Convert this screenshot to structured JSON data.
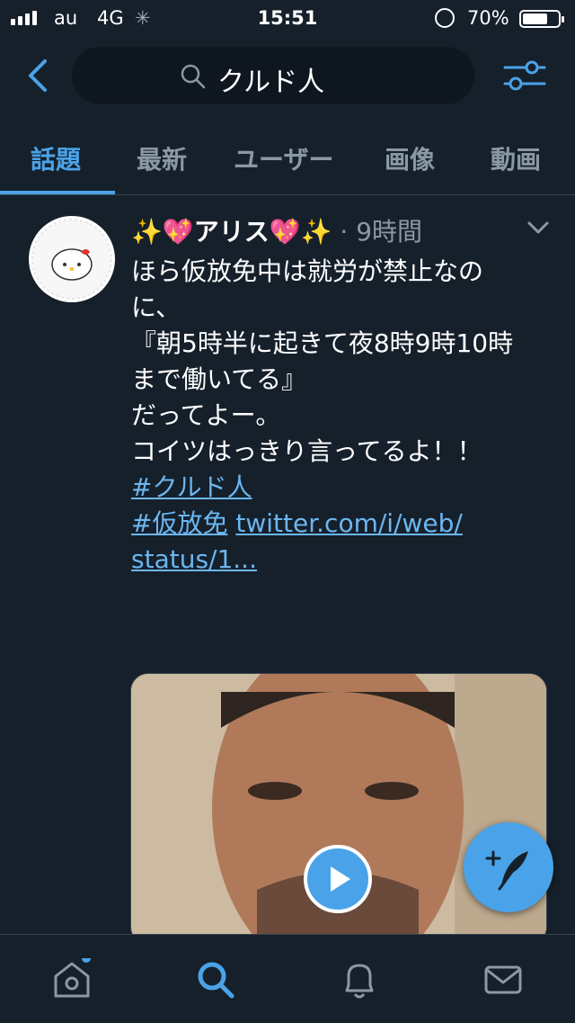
{
  "status_bar": {
    "carrier": "au",
    "network": "4G",
    "time": "15:51",
    "battery_percent": "70%",
    "battery_level": 0.7
  },
  "search": {
    "query": "クルド人"
  },
  "tabs": [
    {
      "label": "話題",
      "active": true
    },
    {
      "label": "最新"
    },
    {
      "label": "ユーザー"
    },
    {
      "label": "画像"
    },
    {
      "label": "動画"
    }
  ],
  "tweet": {
    "user_name": "✨💖アリス💖✨",
    "separator": "·",
    "time_ago": "9時間",
    "body_lines": [
      "ほら仮放免中は就労が禁止なの",
      "に、",
      "『朝5時半に起きて夜8時9時10時",
      "まで働いてる』",
      "だってよー。",
      "",
      "コイツはっきり言ってるよ！！",
      ""
    ],
    "hashtag_1": "#クルド人",
    "hashtag_2": "#仮放免",
    "link_part1": "twitter.com/i/web/",
    "link_part2": "status/1..."
  },
  "icons": {
    "back": "chevron-left-icon",
    "search": "magnifier-icon",
    "filter": "sliders-icon",
    "more": "chevron-down-icon",
    "play": "play-icon",
    "compose": "compose-feather-icon",
    "home": "home-icon",
    "explore": "search-icon",
    "notifications": "bell-icon",
    "messages": "envelope-icon"
  },
  "colors": {
    "background": "#15202b",
    "accent": "#4aa3e8",
    "muted": "#8b98a5",
    "link": "#6cb6f0"
  }
}
